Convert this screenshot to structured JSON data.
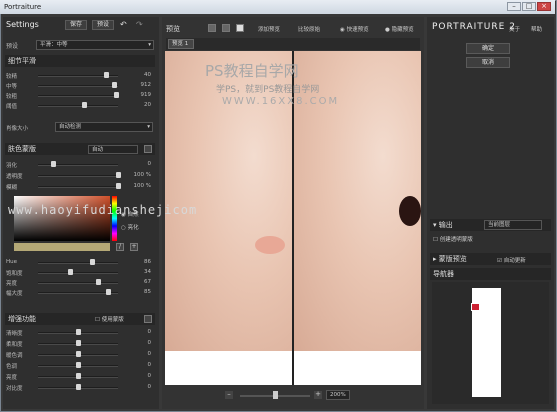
{
  "window": {
    "title": "Portraiture",
    "min": "–",
    "max": "□",
    "close": "×"
  },
  "left": {
    "settings_label": "Settings",
    "save_label": "保存",
    "preset_label": "预设",
    "preset_row_label": "预设",
    "preset_value": "平滑：中等",
    "detail": {
      "title": "细节平滑",
      "sliders": [
        {
          "label": "较精",
          "value": "40"
        },
        {
          "label": "中等",
          "value": "912"
        },
        {
          "label": "较粗",
          "value": "919"
        },
        {
          "label": "阈值",
          "value": "20"
        }
      ],
      "mode_label": "肖像大小",
      "mode_value": "自动检测"
    },
    "skin_mask": {
      "title": "肤色蒙版",
      "mode": "自动",
      "sliders": [
        {
          "label": "羽化",
          "value": "0"
        },
        {
          "label": "透明度",
          "value": "100 %"
        },
        {
          "label": "模糊",
          "value": "100 %"
        }
      ],
      "radio1": "自然",
      "radio2": "亮化",
      "hsv": [
        {
          "label": "Hue",
          "value": "86"
        },
        {
          "label": "饱和度",
          "value": "34"
        },
        {
          "label": "亮度",
          "value": "67"
        },
        {
          "label": "幅大度",
          "value": "85"
        }
      ]
    },
    "enhance": {
      "title": "增强功能",
      "use_mask": "使用蒙版",
      "sliders": [
        {
          "label": "清晰度",
          "value": "0"
        },
        {
          "label": "柔和度",
          "value": "0"
        },
        {
          "label": "暖色调",
          "value": "0"
        },
        {
          "label": "色调",
          "value": "0"
        },
        {
          "label": "亮度",
          "value": "0"
        },
        {
          "label": "对比度",
          "value": "0"
        }
      ]
    }
  },
  "center": {
    "preview_label": "预览",
    "add_preview": "添加预览",
    "compare": "比较原始",
    "quick_preview": "快速预览",
    "hide_preview": "隐藏预览",
    "tab_label": "预览 1",
    "zoom_value": "200%",
    "watermark_line1": "PS教程自学网",
    "watermark_line2": "学PS，就到PS教程自学网",
    "watermark_line3": "WWW.16XX8.COM",
    "watermark_line4": "www.haoyifudianshejicom"
  },
  "right": {
    "brand": "PORTRAITURE 2",
    "about": "关于",
    "help": "帮助",
    "ok": "确定",
    "cancel": "取消",
    "output_label": "输出",
    "output_value": "当前图层",
    "new_layer": "创建透明蒙版",
    "mask_preview": "蒙版预览",
    "auto_update": "自动更新",
    "navigator": "导航器"
  },
  "colors": {
    "skin_swatch": "#d37a55",
    "nav_marker": "#cc2233"
  }
}
